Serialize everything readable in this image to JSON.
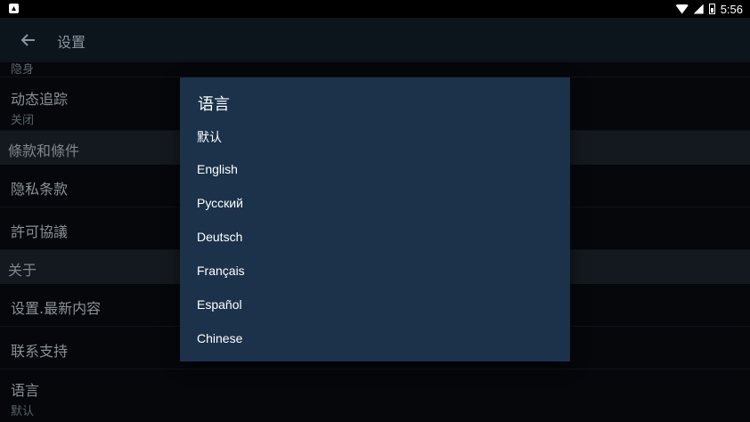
{
  "status_bar": {
    "time": "5:56"
  },
  "app_bar": {
    "title": "设置"
  },
  "list": {
    "partial_row_sub": "隐身",
    "motion_tracking": {
      "title": "动态追踪",
      "sub": "关闭"
    },
    "section_terms": "條款和條件",
    "privacy": "隐私条款",
    "license": "許可協議",
    "section_about": "关于",
    "whats_new": "设置.最新内容",
    "support": "联系支持",
    "language": {
      "title": "语言",
      "sub": "默认"
    }
  },
  "dialog": {
    "title": "语言",
    "options": [
      "默认",
      "English",
      "Русский",
      "Deutsch",
      "Français",
      "Español",
      "Chinese"
    ]
  }
}
